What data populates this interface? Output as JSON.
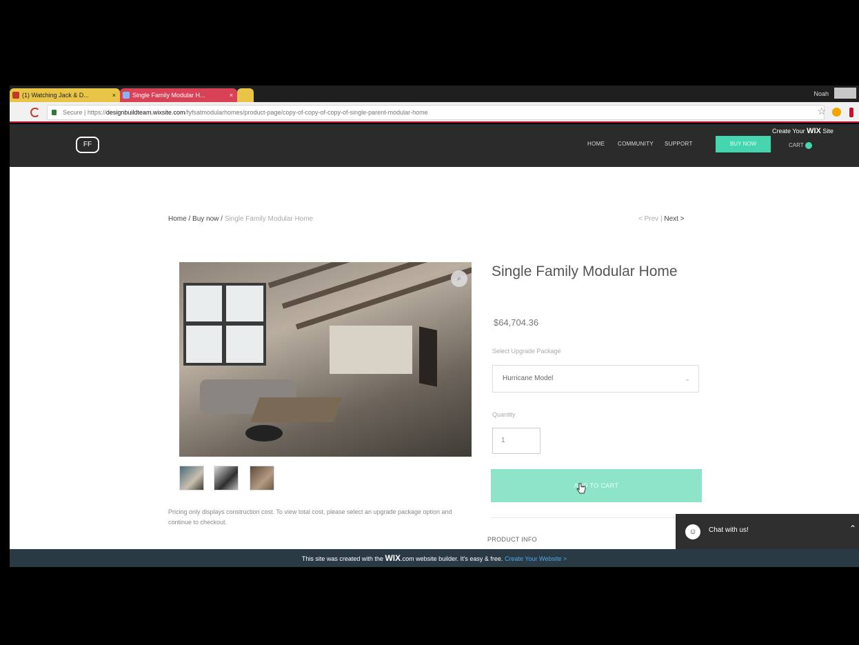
{
  "browser": {
    "tabs": [
      {
        "label": "(1) Watching Jack & D..."
      },
      {
        "label": "Single Family Modular H..."
      },
      {
        "label": ""
      }
    ],
    "profile_name": "Noah",
    "address": {
      "secure_label": "Secure",
      "url_prefix": "https://",
      "url_host": "designbuildteam.wixsite.com",
      "url_path": "/fyfsatmodularhomes/product-page/copy-of-copy-of-copy-of-single-parent-modular-home"
    }
  },
  "header": {
    "logo_text": "FF",
    "nav": [
      "HOME",
      "COMMUNITY",
      "SUPPORT"
    ],
    "buy_now_label": "BUY NOW",
    "create_wix": {
      "prefix": "Create Your",
      "brand": "WIX",
      "suffix": "Site"
    },
    "cart_label": "CART"
  },
  "breadcrumb": {
    "home": "Home",
    "sep1": " / ",
    "buy_now": "Buy now",
    "sep2": " / ",
    "current": "Single Family Modular Home"
  },
  "pager": {
    "prev": "< Prev",
    "sep": " | ",
    "next": "Next >"
  },
  "product": {
    "title": "Single Family Modular Home",
    "price": "$64,704.36",
    "option_label": "Select Upgrade Package",
    "option_value": "Hurricane Model",
    "quantity_label": "Quantity",
    "quantity_value": "1",
    "add_to_cart_label": "ADD TO CART",
    "info_label": "PRODUCT INFO",
    "pricing_note": "Pricing only displays construction cost. To view total cost, please select an upgrade package option and continue to checkout."
  },
  "chat": {
    "label": "Chat with us!"
  },
  "wix_banner": {
    "prefix": "This site was created with the",
    "brand": "WIX",
    "middle": ".com website builder. It's easy & free.",
    "link": "Create Your Website >"
  },
  "colors": {
    "accent": "#45d6b0",
    "add_to_cart": "#8ee4c8",
    "header_bg": "#2b2b2b",
    "banner_bg": "#2a3a45"
  }
}
